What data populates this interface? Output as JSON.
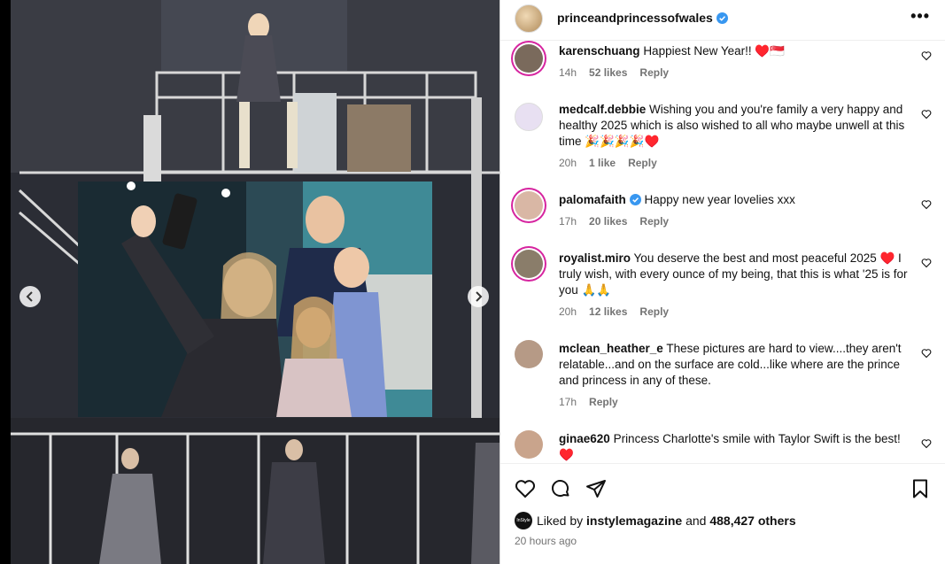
{
  "post": {
    "username": "princeandprincessofwales",
    "verified": true,
    "more_label": "•••"
  },
  "comments": [
    {
      "user": "karenschuang",
      "text": "Happiest New Year!! ♥️🇸🇬",
      "time": "14h",
      "likes": "52 likes",
      "reply": "Reply",
      "avatar_color": "#7a6a5c",
      "ring": true
    },
    {
      "user": "medcalf.debbie",
      "text": "Wishing you and you're family a very happy and healthy 2025 which is also wished to all who maybe unwell at this time 🎉🎉🎉🎉♥️",
      "time": "20h",
      "likes": "1 like",
      "reply": "Reply",
      "avatar_color": "#c7b8e0",
      "ring": false
    },
    {
      "user": "palomafaith",
      "verified": true,
      "text": "Happy new year lovelies xxx",
      "time": "17h",
      "likes": "20 likes",
      "reply": "Reply",
      "avatar_color": "#d9b7a5",
      "ring": true
    },
    {
      "user": "royalist.miro",
      "text": "You deserve the best and most peaceful 2025 ♥️ I truly wish, with every ounce of my being, that this is what '25 is for you 🙏🙏",
      "time": "20h",
      "likes": "12 likes",
      "reply": "Reply",
      "avatar_color": "#8a7d6a",
      "ring": true
    },
    {
      "user": "mclean_heather_e",
      "text": "These pictures are hard to view....they aren't relatable...and on the surface are cold...like where are the prince and princess in any of these.",
      "time": "17h",
      "likes": "",
      "reply": "Reply",
      "avatar_color": "#b69a86",
      "ring": false
    },
    {
      "user": "ginae620",
      "text": "Princess Charlotte's smile with Taylor Swift is the best! ♥️",
      "time": "",
      "likes": "",
      "reply": "",
      "avatar_color": "#c9a48c",
      "ring": false
    }
  ],
  "footer": {
    "liked_prefix": "Liked by",
    "liked_user": "instylemagazine",
    "liked_and": "and",
    "liked_count": "488,427 others",
    "liked_avatar_text": "InStyle",
    "timestamp": "20 hours ago"
  },
  "icons": {
    "like": "heart-icon",
    "comment": "comment-icon",
    "share": "share-icon",
    "save": "bookmark-icon"
  }
}
